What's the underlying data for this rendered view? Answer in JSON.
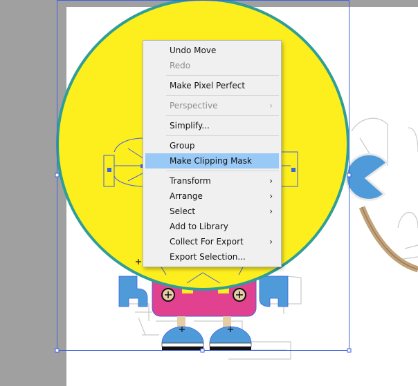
{
  "colors": {
    "pasteboard": "#a0a0a0",
    "artboard": "#ffffff",
    "yellow_circle_fill": "#fdee1e",
    "yellow_circle_stroke": "#2e9e97",
    "selection_blue": "#3f62e0",
    "robot_pink": "#e2418f",
    "robot_blue": "#4f9ad9",
    "menu_background": "#f0f0f0",
    "menu_highlight": "#99c9f6",
    "menu_disabled_text": "#8e8e8e"
  },
  "context_menu": {
    "groups": [
      [
        {
          "label": "Undo Move",
          "enabled": true,
          "submenu": false
        },
        {
          "label": "Redo",
          "enabled": false,
          "submenu": false
        }
      ],
      [
        {
          "label": "Make Pixel Perfect",
          "enabled": true,
          "submenu": false
        }
      ],
      [
        {
          "label": "Perspective",
          "enabled": false,
          "submenu": true
        }
      ],
      [
        {
          "label": "Simplify...",
          "enabled": true,
          "submenu": false
        }
      ],
      [
        {
          "label": "Group",
          "enabled": true,
          "submenu": false
        },
        {
          "label": "Make Clipping Mask",
          "enabled": true,
          "submenu": false,
          "highlighted": true
        }
      ],
      [
        {
          "label": "Transform",
          "enabled": true,
          "submenu": true
        },
        {
          "label": "Arrange",
          "enabled": true,
          "submenu": true
        },
        {
          "label": "Select",
          "enabled": true,
          "submenu": true
        },
        {
          "label": "Add to Library",
          "enabled": true,
          "submenu": false
        },
        {
          "label": "Collect For Export",
          "enabled": true,
          "submenu": true
        },
        {
          "label": "Export Selection...",
          "enabled": true,
          "submenu": false
        }
      ]
    ],
    "submenu_arrow": "›"
  }
}
